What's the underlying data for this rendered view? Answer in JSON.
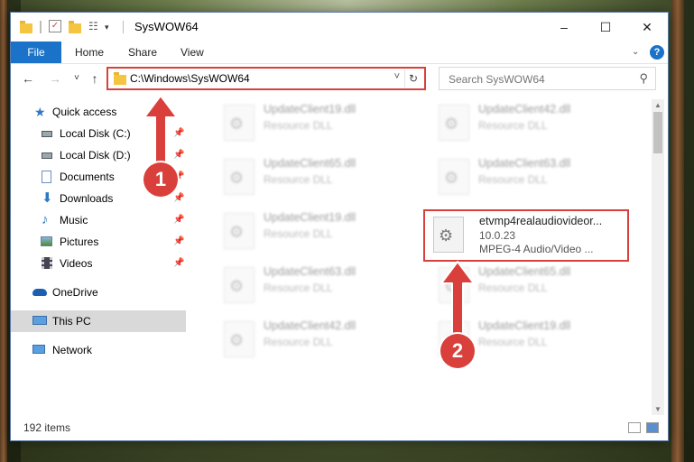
{
  "window": {
    "title": "SysWOW64",
    "controls": {
      "minimize": "–",
      "maximize": "☐",
      "close": "✕"
    }
  },
  "ribbon": {
    "file": "File",
    "tabs": [
      "Home",
      "Share",
      "View"
    ]
  },
  "nav": {
    "back": "←",
    "forward": "→",
    "recent": "˅",
    "up": "↑",
    "address": "C:\\Windows\\SysWOW64",
    "address_dropdown": "˅",
    "refresh": "↻",
    "search_placeholder": "Search SysWOW64"
  },
  "sidebar": {
    "items": [
      {
        "label": "Quick access",
        "icon": "star-icon",
        "pinned": false
      },
      {
        "label": "Local Disk (C:)",
        "icon": "drive-icon",
        "pinned": true
      },
      {
        "label": "Local Disk (D:)",
        "icon": "drive-icon",
        "pinned": true
      },
      {
        "label": "Documents",
        "icon": "documents-icon",
        "pinned": true
      },
      {
        "label": "Downloads",
        "icon": "download-icon",
        "pinned": true
      },
      {
        "label": "Music",
        "icon": "music-icon",
        "pinned": true
      },
      {
        "label": "Pictures",
        "icon": "pictures-icon",
        "pinned": true
      },
      {
        "label": "Videos",
        "icon": "videos-icon",
        "pinned": true
      },
      {
        "label": "OneDrive",
        "icon": "cloud-icon",
        "pinned": false
      },
      {
        "label": "This PC",
        "icon": "computer-icon",
        "pinned": false,
        "selected": true
      },
      {
        "label": "Network",
        "icon": "network-icon",
        "pinned": false
      }
    ]
  },
  "files": [
    {
      "name": "UpdateClient19.dll",
      "line1": "Resource DLL",
      "line2": "",
      "blurred": true
    },
    {
      "name": "UpdateClient42.dll",
      "line1": "Resource DLL",
      "line2": "",
      "blurred": true
    },
    {
      "name": "UpdateClient65.dll",
      "line1": "Resource DLL",
      "line2": "",
      "blurred": true
    },
    {
      "name": "UpdateClient63.dll",
      "line1": "Resource DLL",
      "line2": "",
      "blurred": true
    },
    {
      "name": "UpdateClient19.dll",
      "line1": "Resource DLL",
      "line2": "",
      "blurred": true
    },
    {
      "name": "etvmp4realaudiovideor...",
      "line1": "10.0.23",
      "line2": "MPEG-4 Audio/Video ...",
      "blurred": false
    },
    {
      "name": "UpdateClient63.dll",
      "line1": "Resource DLL",
      "line2": "",
      "blurred": true
    },
    {
      "name": "UpdateClient65.dll",
      "line1": "Resource DLL",
      "line2": "",
      "blurred": true
    },
    {
      "name": "UpdateClient42.dll",
      "line1": "Resource DLL",
      "line2": "",
      "blurred": true
    },
    {
      "name": "UpdateClient19.dll",
      "line1": "Resource DLL",
      "line2": "",
      "blurred": true
    }
  ],
  "status": {
    "item_count": "192 items"
  },
  "annotations": {
    "badge1": "1",
    "badge2": "2",
    "highlight_color": "#d9403b"
  }
}
